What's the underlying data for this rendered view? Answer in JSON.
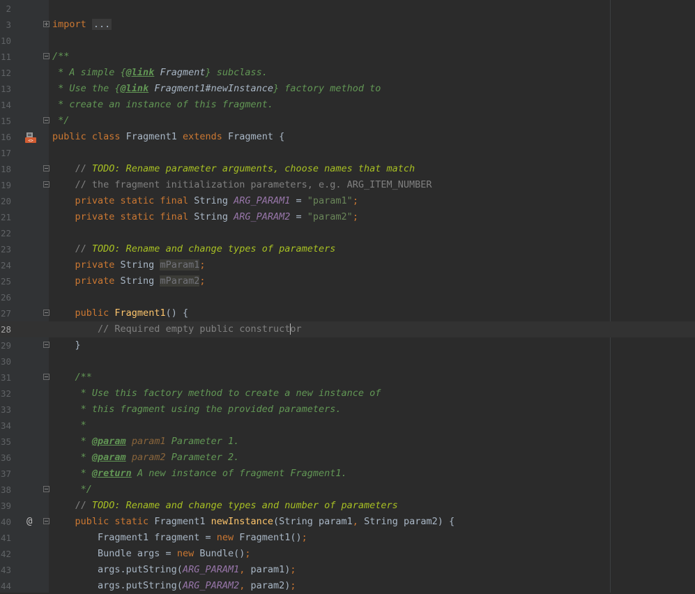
{
  "editor": {
    "lines": [
      {
        "n": "2",
        "code": []
      },
      {
        "n": "3",
        "code": [
          [
            "kw",
            "import"
          ],
          [
            "t",
            " "
          ],
          [
            "fold-text",
            "..."
          ]
        ]
      },
      {
        "n": "10",
        "code": []
      },
      {
        "n": "11",
        "code": [
          [
            "doc",
            "/**"
          ]
        ]
      },
      {
        "n": "12",
        "code": [
          [
            "doc",
            " * A simple {"
          ],
          [
            "doctag",
            "@link"
          ],
          [
            "docref",
            " Fragment"
          ],
          [
            "doc",
            "} subclass."
          ]
        ]
      },
      {
        "n": "13",
        "code": [
          [
            "doc",
            " * Use the {"
          ],
          [
            "doctag",
            "@link"
          ],
          [
            "docref",
            " Fragment1#newInstance"
          ],
          [
            "doc",
            "} factory method to"
          ]
        ]
      },
      {
        "n": "14",
        "code": [
          [
            "doc",
            " * create an instance of this fragment."
          ]
        ]
      },
      {
        "n": "15",
        "code": [
          [
            "doc",
            " */"
          ]
        ]
      },
      {
        "n": "16",
        "code": [
          [
            "kw",
            "public class "
          ],
          [
            "t",
            "Fragment1 "
          ],
          [
            "kw",
            "extends "
          ],
          [
            "t",
            "Fragment {"
          ]
        ]
      },
      {
        "n": "17",
        "code": []
      },
      {
        "n": "18",
        "code": [
          [
            "t",
            "    "
          ],
          [
            "cm",
            "// "
          ],
          [
            "todo",
            "TODO: Rename parameter arguments, choose names that match"
          ]
        ]
      },
      {
        "n": "19",
        "code": [
          [
            "t",
            "    "
          ],
          [
            "cm",
            "// the fragment initialization parameters, e.g. ARG_ITEM_NUMBER"
          ]
        ]
      },
      {
        "n": "20",
        "code": [
          [
            "t",
            "    "
          ],
          [
            "kw",
            "private static final "
          ],
          [
            "t",
            "String "
          ],
          [
            "const",
            "ARG_PARAM1"
          ],
          [
            "t",
            " = "
          ],
          [
            "str",
            "\"param1\""
          ],
          [
            "kw",
            ";"
          ]
        ]
      },
      {
        "n": "21",
        "code": [
          [
            "t",
            "    "
          ],
          [
            "kw",
            "private static final "
          ],
          [
            "t",
            "String "
          ],
          [
            "const",
            "ARG_PARAM2"
          ],
          [
            "t",
            " = "
          ],
          [
            "str",
            "\"param2\""
          ],
          [
            "kw",
            ";"
          ]
        ]
      },
      {
        "n": "22",
        "code": []
      },
      {
        "n": "23",
        "code": [
          [
            "t",
            "    "
          ],
          [
            "cm",
            "// "
          ],
          [
            "todo",
            "TODO: Rename and change types of parameters"
          ]
        ]
      },
      {
        "n": "24",
        "code": [
          [
            "t",
            "    "
          ],
          [
            "kw",
            "private "
          ],
          [
            "t",
            "String "
          ],
          [
            "unused",
            "mParam1"
          ],
          [
            "kw",
            ";"
          ]
        ]
      },
      {
        "n": "25",
        "code": [
          [
            "t",
            "    "
          ],
          [
            "kw",
            "private "
          ],
          [
            "t",
            "String "
          ],
          [
            "unused",
            "mParam2"
          ],
          [
            "kw",
            ";"
          ]
        ]
      },
      {
        "n": "26",
        "code": []
      },
      {
        "n": "27",
        "code": [
          [
            "t",
            "    "
          ],
          [
            "kw",
            "public "
          ],
          [
            "fn",
            "Fragment1"
          ],
          [
            "t",
            "() {"
          ]
        ]
      },
      {
        "n": "28",
        "code": [
          [
            "t",
            "        "
          ],
          [
            "cm",
            "// Required empty public construct"
          ],
          [
            "caret",
            ""
          ],
          [
            "cm",
            "or"
          ]
        ]
      },
      {
        "n": "29",
        "code": [
          [
            "t",
            "    }"
          ]
        ]
      },
      {
        "n": "30",
        "code": []
      },
      {
        "n": "31",
        "code": [
          [
            "t",
            "    "
          ],
          [
            "doc",
            "/**"
          ]
        ]
      },
      {
        "n": "32",
        "code": [
          [
            "t",
            "    "
          ],
          [
            "doc",
            " * Use this factory method to create a new instance of"
          ]
        ]
      },
      {
        "n": "33",
        "code": [
          [
            "t",
            "    "
          ],
          [
            "doc",
            " * this fragment using the provided parameters."
          ]
        ]
      },
      {
        "n": "34",
        "code": [
          [
            "t",
            "    "
          ],
          [
            "doc",
            " *"
          ]
        ]
      },
      {
        "n": "35",
        "code": [
          [
            "t",
            "    "
          ],
          [
            "doc",
            " * "
          ],
          [
            "doctag",
            "@param"
          ],
          [
            "t",
            " "
          ],
          [
            "docparam",
            "param1"
          ],
          [
            "doc",
            " Parameter 1."
          ]
        ]
      },
      {
        "n": "36",
        "code": [
          [
            "t",
            "    "
          ],
          [
            "doc",
            " * "
          ],
          [
            "doctag",
            "@param"
          ],
          [
            "t",
            " "
          ],
          [
            "docparam",
            "param2"
          ],
          [
            "doc",
            " Parameter 2."
          ]
        ]
      },
      {
        "n": "37",
        "code": [
          [
            "t",
            "    "
          ],
          [
            "doc",
            " * "
          ],
          [
            "doctag",
            "@return"
          ],
          [
            "doc",
            " A new instance of fragment Fragment1."
          ]
        ]
      },
      {
        "n": "38",
        "code": [
          [
            "t",
            "    "
          ],
          [
            "doc",
            " */"
          ]
        ]
      },
      {
        "n": "39",
        "code": [
          [
            "t",
            "    "
          ],
          [
            "cm",
            "// "
          ],
          [
            "todo",
            "TODO: Rename and change types and number of parameters"
          ]
        ]
      },
      {
        "n": "40",
        "code": [
          [
            "t",
            "    "
          ],
          [
            "kw",
            "public static "
          ],
          [
            "t",
            "Fragment1 "
          ],
          [
            "fn",
            "newInstance"
          ],
          [
            "t",
            "(String param1"
          ],
          [
            "kw",
            ", "
          ],
          [
            "t",
            "String param2) {"
          ]
        ]
      },
      {
        "n": "41",
        "code": [
          [
            "t",
            "        Fragment1 fragment = "
          ],
          [
            "kw",
            "new "
          ],
          [
            "t",
            "Fragment1()"
          ],
          [
            "kw",
            ";"
          ]
        ]
      },
      {
        "n": "42",
        "code": [
          [
            "t",
            "        Bundle args = "
          ],
          [
            "kw",
            "new "
          ],
          [
            "t",
            "Bundle()"
          ],
          [
            "kw",
            ";"
          ]
        ]
      },
      {
        "n": "43",
        "code": [
          [
            "t",
            "        args.putString("
          ],
          [
            "const",
            "ARG_PARAM1"
          ],
          [
            "kw",
            ", "
          ],
          [
            "t",
            "param1)"
          ],
          [
            "kw",
            ";"
          ]
        ]
      },
      {
        "n": "44",
        "code": [
          [
            "t",
            "        args.putString("
          ],
          [
            "const",
            "ARG_PARAM2"
          ],
          [
            "kw",
            ", "
          ],
          [
            "t",
            "param2)"
          ],
          [
            "kw",
            ";"
          ]
        ]
      }
    ]
  },
  "gutter": {
    "class_icon_line": "16",
    "override_icon_line": "40",
    "override_icon_glyph": "@",
    "current_line": "28"
  },
  "colors": {
    "background": "#2b2b2b",
    "gutter": "#313335",
    "keyword": "#cc7832",
    "doc_comment": "#629755",
    "todo": "#a8c023",
    "constant": "#9876aa",
    "string": "#6a8759",
    "method": "#ffc66d"
  }
}
